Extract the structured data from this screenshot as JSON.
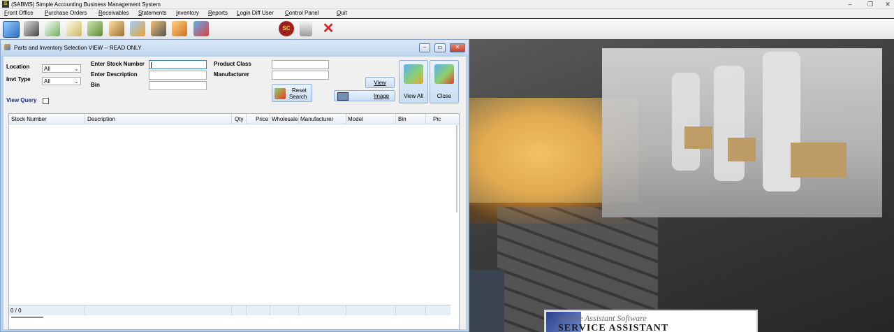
{
  "app": {
    "title": "(SABMS) Simple Accounting Business Management System",
    "icon_glyph": "S",
    "window_controls": {
      "minimize": "‒",
      "restore": "❐",
      "close": "✕"
    }
  },
  "menu": {
    "items": [
      "Front Office",
      "Purchase Orders",
      "Receivables",
      "Statements",
      "Inventory",
      "Reports",
      "Login Diff User",
      "Control Panel",
      "Quit"
    ]
  },
  "toolbar": {
    "icons": [
      "help-icon",
      "tools-icon",
      "checklist-icon",
      "document-icon",
      "money-icon",
      "report-icon",
      "calendar-icon",
      "users-icon",
      "handshake-icon",
      "boxes-icon",
      "sc-icon",
      "calculator-icon",
      "exit-icon"
    ],
    "sc_text": "SC"
  },
  "window": {
    "title": "Parts and Inventory Selection  VIEW -- READ ONLY",
    "buttons": {
      "minimize": "‒",
      "restore": "▭",
      "close": "✕"
    }
  },
  "form": {
    "location_label": "Location",
    "location_value": "All",
    "invt_type_label": "Invt Type",
    "invt_type_value": "All",
    "view_query_label": "View Query",
    "stock_number_label": "Enter Stock Number",
    "description_label": "Enter Description",
    "bin_label": "Bin",
    "product_class_label": "Product Class",
    "manufacturer_label": "Manufacturer",
    "stock_number_value": "",
    "description_value": "",
    "bin_value": "",
    "product_class_value": "",
    "manufacturer_value": "",
    "dropdown_glyph": "⌄"
  },
  "buttons": {
    "reset_line1": "Reset",
    "reset_line2": "Search",
    "view": "View",
    "image": "Image",
    "view_all": "View All",
    "close": "Close"
  },
  "grid": {
    "columns": [
      "Stock Number",
      "Description",
      "Qty",
      "Price",
      "Wholesale",
      "Manufacturer",
      "Model",
      "Bin",
      "Pic"
    ],
    "rows": [],
    "count": "0 / 0"
  },
  "background": {
    "logo_line1": "Service Assistant Software",
    "logo_line2": "SERVICE ASSISTANT"
  },
  "colors": {
    "window_border": "#b9d1ea",
    "label_blue": "#1c2a8c",
    "close_red": "#c2432c"
  }
}
